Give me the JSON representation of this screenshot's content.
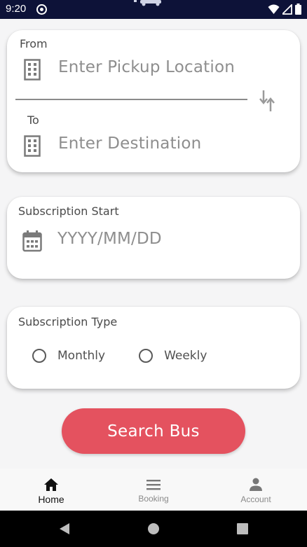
{
  "status": {
    "time": "9:20"
  },
  "location": {
    "from_label": "From",
    "from_placeholder": "Enter Pickup Location",
    "to_label": "To",
    "to_placeholder": "Enter Destination"
  },
  "subscription_start": {
    "label": "Subscription Start",
    "placeholder": "YYYY/MM/DD"
  },
  "subscription_type": {
    "label": "Subscription Type",
    "options": [
      "Monthly",
      "Weekly"
    ]
  },
  "search_button": "Search Bus",
  "bottom_nav": [
    {
      "label": "Home",
      "icon": "home-icon",
      "active": true
    },
    {
      "label": "Booking",
      "icon": "menu-icon",
      "active": false
    },
    {
      "label": "Account",
      "icon": "person-icon",
      "active": false
    }
  ],
  "colors": {
    "status_bar": "#0d1238",
    "accent": "#e4525f"
  }
}
